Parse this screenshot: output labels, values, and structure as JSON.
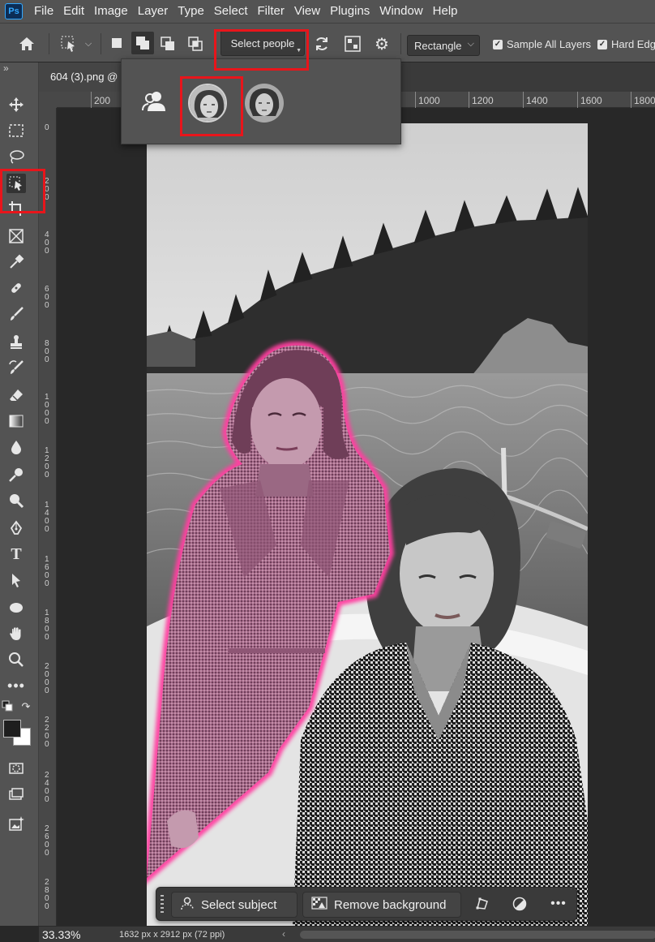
{
  "menu": [
    "File",
    "Edit",
    "Image",
    "Layer",
    "Type",
    "Select",
    "Filter",
    "View",
    "Plugins",
    "Window",
    "Help"
  ],
  "app_logo": "Ps",
  "options": {
    "select_people_label": "Select people",
    "mode_value": "Rectangle",
    "sample_all_layers_label": "Sample All Layers",
    "hard_edge_label": "Hard Edge"
  },
  "document": {
    "tab_title": "604 (3).png @"
  },
  "ruler": {
    "h_labels": [
      "200",
      "1000",
      "1200",
      "1400",
      "1600",
      "1800"
    ],
    "v_labels": [
      "0",
      "200",
      "400",
      "600",
      "800",
      "1000",
      "1200",
      "1400",
      "1600",
      "1800",
      "2000",
      "2200",
      "2400",
      "2600",
      "2800"
    ]
  },
  "toolbar": {
    "collapse_glyph": "»",
    "tools": [
      "move-icon",
      "marquee-icon",
      "lasso-icon",
      "object-selection-icon",
      "crop-icon",
      "frame-icon",
      "eyedropper-icon",
      "healing-icon",
      "brush-icon",
      "stamp-icon",
      "history-brush-icon",
      "eraser-icon",
      "gradient-icon",
      "blur-icon",
      "dodge-icon",
      "smudge-icon",
      "pen-icon",
      "type-icon",
      "path-select-icon",
      "ellipse-icon",
      "hand-icon",
      "zoom-icon",
      "more-icon"
    ]
  },
  "taskbar": {
    "select_subject_label": "Select subject",
    "remove_background_label": "Remove background"
  },
  "status": {
    "zoom": "33.33%",
    "doc_size": "1632 px x 2912 px (72 ppi)"
  },
  "colors": {
    "highlight": "#e8151b",
    "selection_glow": "#ff4fa8",
    "panel": "#535353"
  }
}
